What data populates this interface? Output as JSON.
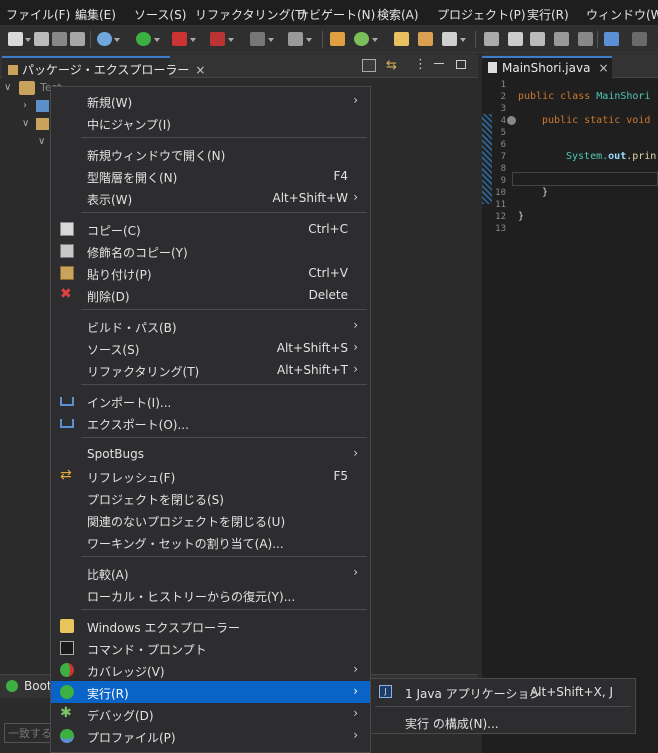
{
  "menubar": {
    "items": [
      "ファイル(F)",
      "編集(E)",
      "ソース(S)",
      "リファクタリング(T)",
      "ナビゲート(N)",
      "検索(A)",
      "プロジェクト(P)",
      "実行(R)",
      "ウィンドウ(W)"
    ]
  },
  "package_explorer": {
    "tab_label": "パッケージ・エクスプローラー",
    "tree_root": "Test"
  },
  "editor": {
    "tab_label": "MainShori.java",
    "line_numbers": [
      "1",
      "2",
      "3",
      "4",
      "5",
      "6",
      "7",
      "8",
      "9",
      "10",
      "11",
      "12",
      "13"
    ],
    "code": {
      "l2_kw": "public class",
      "l2_name": "MainShori",
      "l4_kw": "public static void",
      "l7_sys": "System.",
      "l7_out": "out",
      "l7_rest": ".prin",
      "l11": "}",
      "l12": "}"
    }
  },
  "bottom_panel": {
    "tab_label": "Boot",
    "filter_placeholder": "一致する"
  },
  "context_menu": {
    "items": {
      "new": {
        "label": "新規(W)"
      },
      "goto": {
        "label": "中にジャンプ(I)"
      },
      "open_new_window": {
        "label": "新規ウィンドウで開く(N)"
      },
      "open_type_hierarchy": {
        "label": "型階層を開く(N)",
        "shortcut": "F4"
      },
      "show_in": {
        "label": "表示(W)",
        "shortcut": "Alt+Shift+W"
      },
      "copy": {
        "label": "コピー(C)",
        "shortcut": "Ctrl+C"
      },
      "copy_qualified": {
        "label": "修飾名のコピー(Y)"
      },
      "paste": {
        "label": "貼り付け(P)",
        "shortcut": "Ctrl+V"
      },
      "delete": {
        "label": "削除(D)",
        "shortcut": "Delete"
      },
      "build_path": {
        "label": "ビルド・パス(B)"
      },
      "source": {
        "label": "ソース(S)",
        "shortcut": "Alt+Shift+S"
      },
      "refactor": {
        "label": "リファクタリング(T)",
        "shortcut": "Alt+Shift+T"
      },
      "import": {
        "label": "インポート(I)..."
      },
      "export": {
        "label": "エクスポート(O)..."
      },
      "spotbugs": {
        "label": "SpotBugs"
      },
      "refresh": {
        "label": "リフレッシュ(F)",
        "shortcut": "F5"
      },
      "close_project": {
        "label": "プロジェクトを閉じる(S)"
      },
      "close_unrelated": {
        "label": "関連のないプロジェクトを閉じる(U)"
      },
      "assign_working_sets": {
        "label": "ワーキング・セットの割り当て(A)..."
      },
      "compare": {
        "label": "比較(A)"
      },
      "restore_local_history": {
        "label": "ローカル・ヒストリーからの復元(Y)..."
      },
      "windows_explorer": {
        "label": "Windows エクスプローラー"
      },
      "command_prompt": {
        "label": "コマンド・プロンプト"
      },
      "coverage": {
        "label": "カバレッジ(V)"
      },
      "run": {
        "label": "実行(R)"
      },
      "debug": {
        "label": "デバッグ(D)"
      },
      "profile": {
        "label": "プロファイル(P)"
      }
    }
  },
  "run_submenu": {
    "java_app": {
      "label": "1 Java アプリケーション",
      "shortcut": "Alt+Shift+X, J"
    },
    "run_config": {
      "label": "実行 の構成(N)..."
    }
  },
  "colors": {
    "menu_bg": "#2d2d30",
    "highlight": "#0a64c8",
    "keyword": "#cc7832",
    "class_name": "#4ec9b0",
    "accent_tab": "#3d7cc9"
  },
  "icons": [
    "refresh-icon",
    "copy-icon",
    "paste-icon",
    "delete-icon",
    "import-icon",
    "export-icon",
    "folder-icon",
    "terminal-icon",
    "run-icon",
    "debug-icon",
    "coverage-icon",
    "profile-icon",
    "java-app-icon"
  ]
}
